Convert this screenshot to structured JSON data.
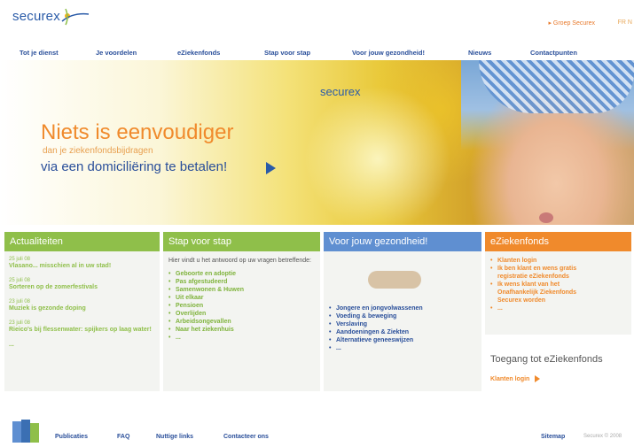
{
  "brand": {
    "logo_text": "securex",
    "hero_logo_text": "securex"
  },
  "header": {
    "groep_link": "Groep Securex",
    "lang": "FR  N"
  },
  "nav": [
    {
      "label": "Tot je dienst"
    },
    {
      "label": "Je voordelen"
    },
    {
      "label": "eZiekenfonds"
    },
    {
      "label": "Stap voor stap"
    },
    {
      "label": "Voor jouw gezondheid!"
    },
    {
      "label": "Nieuws"
    },
    {
      "label": "Contactpunten"
    }
  ],
  "hero": {
    "title": "Niets is eenvoudiger",
    "sub": "dan je ziekenfondsbijdragen",
    "sub2": "via een domiciliëring te betalen!"
  },
  "colors": {
    "green": "#7fb33c",
    "blue": "#5f8fd1",
    "orange": "#f08a2c"
  },
  "columns": {
    "actualiteiten": {
      "title": "Actualiteiten",
      "items": [
        {
          "date": "25 juli 08",
          "title": "Vlasano... misschien al in uw stad!"
        },
        {
          "date": "25 juli 08",
          "title": "Sorteren op de zomerfestivals"
        },
        {
          "date": "23 juli 08",
          "title": "Muziek is gezonde doping"
        },
        {
          "date": "23 juli 08",
          "title": "Rieico's bij flessenwater: spijkers op laag water!"
        }
      ],
      "more": "..."
    },
    "stap": {
      "title": "Stap voor stap",
      "intro": "Hier vindt u het antwoord op uw vragen betreffende:",
      "items": [
        "Geboorte en adoptie",
        "Pas afgestudeerd",
        "Samenwonen & Huwen",
        "Uit elkaar",
        "Pensioen",
        "Overlijden",
        "Arbeidsongevallen",
        "Naar het ziekenhuis",
        "..."
      ]
    },
    "gezondheid": {
      "title": "Voor jouw gezondheid!",
      "items": [
        "Jongere en jongvolwassenen",
        "Voeding & beweging",
        "Verslaving",
        "Aandoeningen & Ziekten",
        "Alternatieve geneeswijzen",
        "..."
      ]
    },
    "eziekenfonds": {
      "title": "eZiekenfonds",
      "items": [
        "Klanten login",
        "Ik ben klant en wens gratis",
        "registratie eZiekenfonds",
        "Ik wens klant van het",
        "Onafhankelijk Ziekenfonds",
        "Securex worden",
        "..."
      ],
      "toegang": "Toegang tot eZiekenfonds",
      "klanten_login": "Klanten login"
    }
  },
  "footer": {
    "links": [
      "Publicaties",
      "FAQ",
      "Nuttige links",
      "Contacteer ons"
    ],
    "sitemap": "Sitemap",
    "copyright": "Securex © 2008"
  }
}
